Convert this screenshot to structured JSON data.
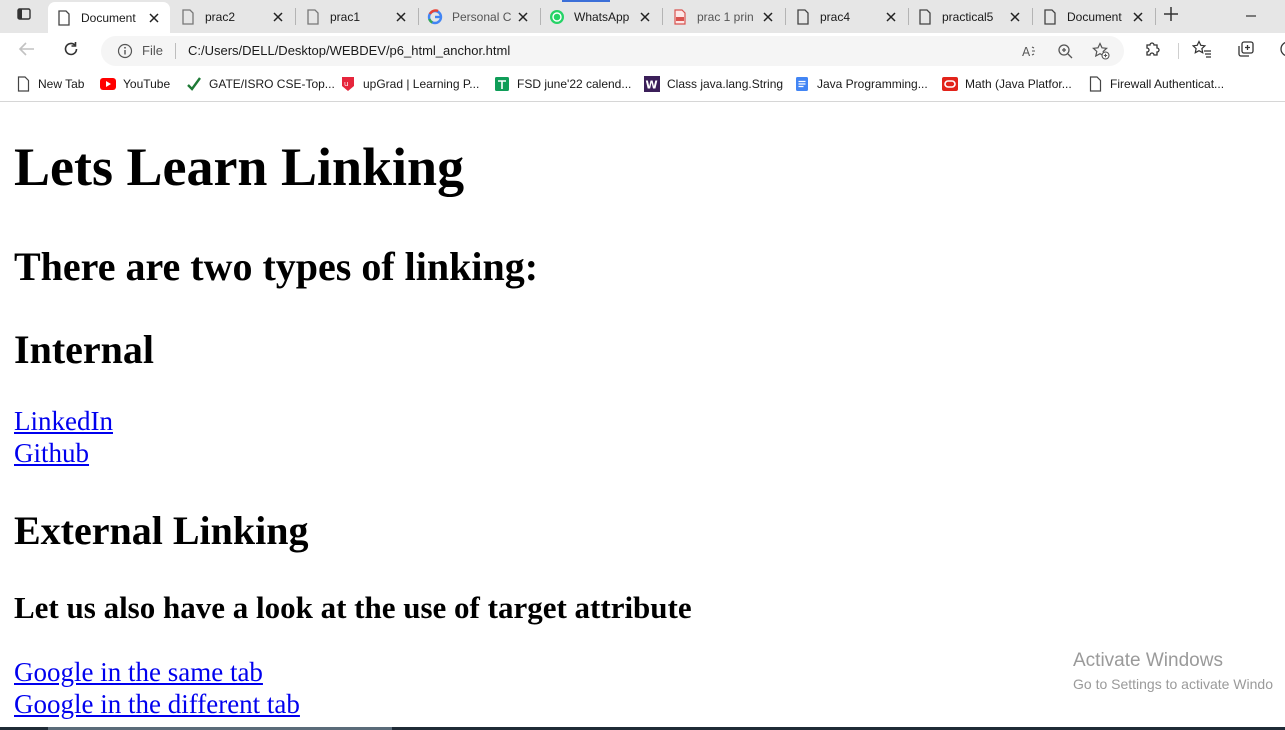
{
  "tabs": [
    {
      "title": "Document",
      "icon": "page-icon",
      "active": true
    },
    {
      "title": "prac2",
      "icon": "page-icon",
      "active": false
    },
    {
      "title": "prac1",
      "icon": "page-icon",
      "active": false
    },
    {
      "title": "Personal C",
      "icon": "google-icon",
      "active": false
    },
    {
      "title": "WhatsApp",
      "icon": "whatsapp-icon",
      "active": false
    },
    {
      "title": "prac 1 prin",
      "icon": "pdf-icon",
      "active": false
    },
    {
      "title": "prac4",
      "icon": "page-icon",
      "active": false
    },
    {
      "title": "practical5",
      "icon": "page-icon",
      "active": false
    },
    {
      "title": "Document",
      "icon": "page-icon",
      "active": false
    }
  ],
  "address_bar": {
    "scheme_label": "File",
    "url": "C:/Users/DELL/Desktop/WEBDEV/p6_html_anchor.html"
  },
  "bookmarks": [
    {
      "label": "New Tab",
      "icon": "page-icon"
    },
    {
      "label": "YouTube",
      "icon": "youtube-icon"
    },
    {
      "label": "GATE/ISRO CSE-Top...",
      "icon": "checkmark-icon"
    },
    {
      "label": "upGrad | Learning P...",
      "icon": "upgrad-icon"
    },
    {
      "label": "FSD june'22 calend...",
      "icon": "calendar-icon"
    },
    {
      "label": "Class java.lang.String",
      "icon": "w-icon"
    },
    {
      "label": "Java Programming...",
      "icon": "docs-icon"
    },
    {
      "label": "Math (Java Platfor...",
      "icon": "oracle-icon"
    },
    {
      "label": "Firewall Authenticat...",
      "icon": "page-icon"
    }
  ],
  "page": {
    "heading": "Lets Learn Linking",
    "subheading": "There are two types of linking:",
    "internal_heading": "Internal",
    "internal_links": [
      "LinkedIn",
      "Github"
    ],
    "external_heading": "External Linking",
    "target_heading": "Let us also have a look at the use of target attribute",
    "target_links": [
      "Google in the same tab",
      "Google in the different tab"
    ]
  },
  "watermark": {
    "line1": "Activate Windows",
    "line2": "Go to Settings to activate Windo"
  },
  "colors": {
    "link": "#0000ee",
    "tabstrip": "#e6e6e6",
    "addressbar": "#f5f5f5"
  }
}
